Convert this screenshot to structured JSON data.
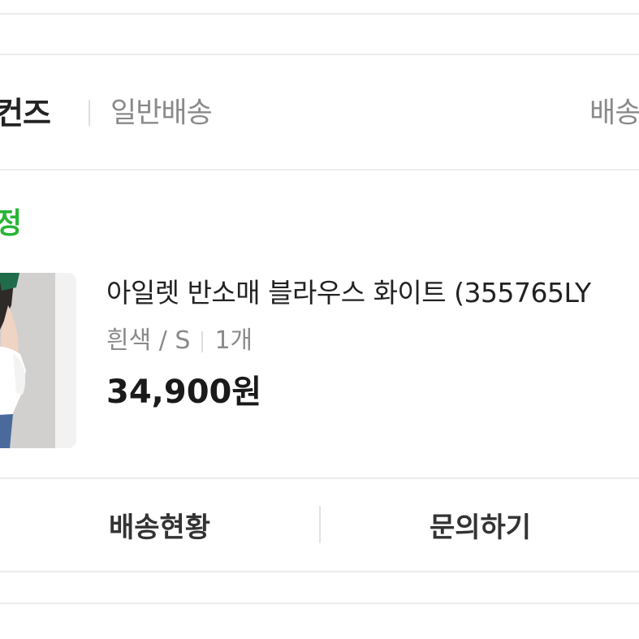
{
  "seller": {
    "name": "컨즈",
    "shipping_type": "일반배송",
    "right_label_partial": "배송"
  },
  "order": {
    "status": "정",
    "status_color": "#27b535"
  },
  "product": {
    "name": "아일렛 반소매 블라우스 화이트 (355765LY",
    "option_color_size": "흰색 / S",
    "quantity": "1개",
    "price": "34,900원",
    "thumbnail_icon": "product-photo"
  },
  "actions": {
    "track_delivery": "배송현황",
    "inquiry": "문의하기"
  }
}
